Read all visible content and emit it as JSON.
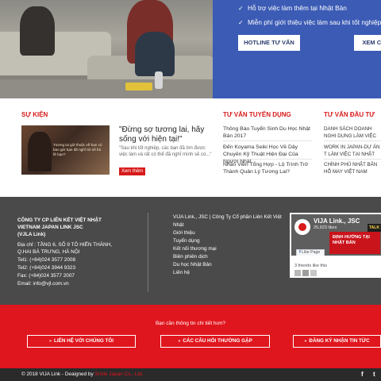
{
  "hero": {
    "lines": [
      "Hỗ trợ việc làm thêm tại Nhật Bản",
      "Miễn phí giới thiệu việc làm sau khi tốt nghiệp"
    ],
    "buttons": [
      "HOTLINE TƯ VẤN",
      "XEM CH"
    ],
    "check_icon": "check-icon"
  },
  "events": {
    "heading": "SỰ KIỆN",
    "title": "\"Đừng sợ tương lai, hãy sống với hiện tại!\"",
    "excerpt": "\"Sau khi tốt nghiệp, các bạn đã tìm được việc làm và rất có thể đã nghĩ mình sẽ có...\"",
    "more": "Xem thêm",
    "image_caption": "Tương lai giờ thuộc về bạn có bao giờ bạn đã nghĩ tới sẽ bỏ lỡ bạn?"
  },
  "recruitment": {
    "heading": "TƯ VẤN TUYỂN DỤNG",
    "items": [
      "Thông Báo Tuyển Sinh Du Học Nhật Bản 2017",
      "Đến Koyama Seiki Học Về Dây Chuyền Kỹ Thuật Hiện Đại Của Người Nhật",
      "Nhân Viên Tổng Hợp - Lộ Trình Trở Thành Quản Lý Tương Lai?"
    ]
  },
  "investment": {
    "heading": "TƯ VẤN ĐẦU TƯ",
    "items": [
      "DANH SÁCH DOANH NGHI DỤNG LÀM VIỆC TẠI NH",
      "WORK IN JAPAN-DỰ ÁN T LÀM VIỆC TẠI NHẬT BẢN",
      "CHÍNH PHỦ NHẬT BẢN HỖ MAY VIỆT NAM"
    ]
  },
  "company": {
    "name_lines": [
      "CÔNG TY CP LIÊN KẾT VIỆT NHẬT",
      "VIETNAM JAPAN LINK JSC",
      "(VJLA Link)"
    ],
    "address_lines": [
      "Địa chỉ : TẦNG 6, SỐ 9 TÔ HIẾN THÀNH,",
      "Q.HAI BÀ TRƯNG, HÀ NỘI"
    ],
    "tel1": "Tel1: (+84)024 3577 2008",
    "tel2": "Tel2: (+84)024 3944 9323",
    "fax": "Fax: (+84)024 3577 2007",
    "email": "Email: info@vjl.com.vn"
  },
  "footer_links": [
    "VIJA Link., JSC | Công Ty Cổ phần Liên Kết Việt",
    "Nhật",
    "Giới thiệu",
    "Tuyển dụng",
    "Kết nối thương mại",
    "Biên phiên dịch",
    "Du học Nhật Bản",
    "Liên hệ"
  ],
  "facebook": {
    "page_name": "VIJA Link., JSC",
    "likes": "25,923 likes",
    "talk": "TALK SH",
    "banner_text": "ĐỊNH HƯỚNG  TẠI NHẬT BẢN",
    "like_button": "Like Page",
    "friends": "3 friends like this"
  },
  "cta": {
    "question": "Bạn cần thông tin chi tiết hơn?",
    "buttons": [
      "LIÊN HỆ VỚI CHÚNG TÔI",
      "CÁC CÂU HỎI THƯỜNG GẶP",
      "ĐĂNG KÝ NHẬN TIN TỨC"
    ],
    "arrow_icon": "double-chevron-right-icon"
  },
  "bottom": {
    "copyright": "© 2018 VIJA Link - Deaigned by ",
    "designer": "Smile Japan Co., Ltd.",
    "social": [
      "f",
      "t"
    ]
  },
  "colors": {
    "brand_red": "#e0161e",
    "hero_blue": "#3b5bb5",
    "footer_gray": "#4a4a4a",
    "bottom_bar": "#2a2a2a"
  }
}
